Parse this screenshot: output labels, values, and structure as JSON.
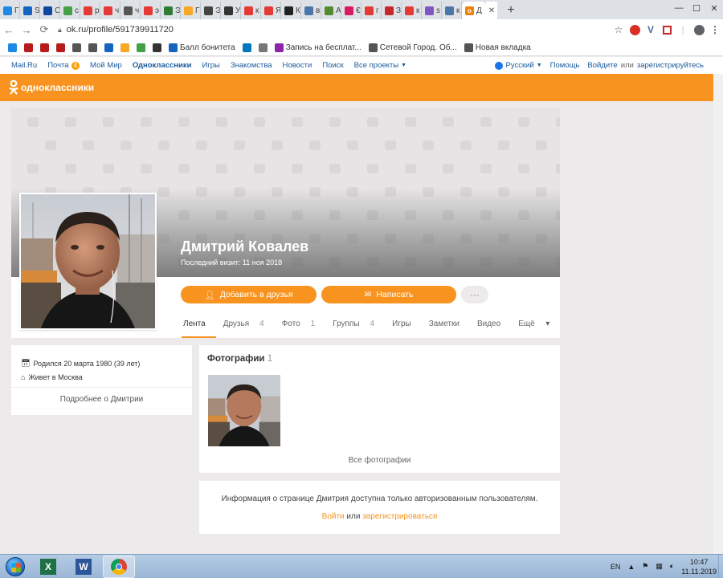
{
  "browser": {
    "tabs": [
      {
        "letter": "Г",
        "color": "#1e88e5",
        "icon": "ie-globe-icon"
      },
      {
        "letter": "S",
        "color": "#1565c0",
        "icon": "globe-icon"
      },
      {
        "letter": "С",
        "color": "#0d47a1",
        "icon": "chinese-char-icon"
      },
      {
        "letter": "с",
        "color": "#43a047",
        "icon": "leaf-icon"
      },
      {
        "letter": "р",
        "color": "#e53935",
        "icon": "yandex-icon"
      },
      {
        "letter": "ч",
        "color": "#e53935",
        "icon": "yandex-icon"
      },
      {
        "letter": "ч",
        "color": "#555555",
        "icon": "globe-icon"
      },
      {
        "letter": "э",
        "color": "#e53935",
        "icon": "yandex-icon"
      },
      {
        "letter": "Э",
        "color": "#2e7d32",
        "icon": "horse-icon"
      },
      {
        "letter": "Г",
        "color": "#f9a825",
        "icon": "k-icon"
      },
      {
        "letter": "Э",
        "color": "#444444",
        "icon": "wn-icon"
      },
      {
        "letter": "У",
        "color": "#333333",
        "icon": "graduation-cap-icon"
      },
      {
        "letter": "к",
        "color": "#e53935",
        "icon": "yandex-icon"
      },
      {
        "letter": "Я",
        "color": "#e53935",
        "icon": "map-pin-icon"
      },
      {
        "letter": "К",
        "color": "#222222",
        "icon": "horse-icon"
      },
      {
        "letter": "в",
        "color": "#4a76a8",
        "icon": "vk-icon"
      },
      {
        "letter": "А",
        "color": "#558b2f",
        "icon": "badge-icon"
      },
      {
        "letter": "€",
        "color": "#d81b60",
        "icon": "instagram-icon"
      },
      {
        "letter": "г",
        "color": "#e53935",
        "icon": "yandex-icon"
      },
      {
        "letter": "З",
        "color": "#c62828",
        "icon": "x-icon"
      },
      {
        "letter": "к",
        "color": "#e53935",
        "icon": "yandex-icon"
      },
      {
        "letter": "s",
        "color": "#7e57c2",
        "icon": "gear-icon"
      },
      {
        "letter": "к",
        "color": "#4a76a8",
        "icon": "vk-icon"
      }
    ],
    "active_tab": "Д",
    "url": "ok.ru/profile/591739911720",
    "bookmarks": [
      {
        "label": "",
        "color": "#1e88e5",
        "icon": "mail-icon"
      },
      {
        "label": "",
        "color": "#b71c1c",
        "icon": "eagle-icon"
      },
      {
        "label": "",
        "color": "#b71c1c",
        "icon": "eagle-icon"
      },
      {
        "label": "",
        "color": "#b71c1c",
        "icon": "eagle-icon"
      },
      {
        "label": "",
        "color": "#555555",
        "icon": "globe-icon"
      },
      {
        "label": "",
        "color": "#555555",
        "icon": "globe-icon"
      },
      {
        "label": "",
        "color": "#1565c0",
        "icon": "arrows-icon"
      },
      {
        "label": "",
        "color": "#f9a825",
        "icon": "sun-icon"
      },
      {
        "label": "",
        "color": "#43a047",
        "icon": "h-icon"
      },
      {
        "label": "",
        "color": "#333333",
        "icon": "film-icon"
      },
      {
        "label": "Балл бонитета",
        "color": "#1565c0",
        "icon": "bookmark-icon"
      },
      {
        "label": "",
        "color": "#0277bd",
        "icon": "cd-icon"
      },
      {
        "label": "",
        "color": "#777777",
        "icon": "eagle-icon"
      },
      {
        "label": "Запись на бесплат...",
        "color": "#8e24aa",
        "icon": "people-icon"
      },
      {
        "label": "Сетевой Город. Об...",
        "color": "#555555",
        "icon": "page-icon"
      },
      {
        "label": "Новая вкладка",
        "color": "#555555",
        "icon": "globe-icon"
      }
    ]
  },
  "portal": {
    "links": [
      "Mail.Ru",
      "Почта",
      "Мой Мир",
      "Одноклассники",
      "Игры",
      "Знакомства",
      "Новости",
      "Поиск",
      "Все проекты"
    ],
    "mail_badge": "4",
    "language": "Русский",
    "help": "Помощь",
    "login": "Войдите",
    "or": "или",
    "register": "зарегистрируйтесь"
  },
  "site": {
    "logo": "одноклассники",
    "accent": "#f7931e"
  },
  "profile": {
    "name": "Дмитрий Ковалев",
    "last_visit": "Последний визит: 11 ноя 2018",
    "add_friend": "Добавить в друзья",
    "write": "Написать",
    "more": "···",
    "tabs": [
      {
        "label": "Лента",
        "count": ""
      },
      {
        "label": "Друзья",
        "count": "4"
      },
      {
        "label": "Фото",
        "count": "1"
      },
      {
        "label": "Группы",
        "count": "4"
      },
      {
        "label": "Игры",
        "count": ""
      },
      {
        "label": "Заметки",
        "count": ""
      },
      {
        "label": "Видео",
        "count": ""
      },
      {
        "label": "Ещё",
        "count": ""
      }
    ],
    "born": "Родился 20 марта 1980 (39 лет)",
    "lives": "Живет в Москва",
    "more_about": "Подробнее о Дмитрии"
  },
  "photos": {
    "title": "Фотографии",
    "count": "1",
    "all": "Все фотографии"
  },
  "auth": {
    "message": "Информация о странице Дмитрия доступна только авторизованным пользователям.",
    "login": "Войти",
    "or": "или",
    "register": "зарегистрироваться"
  },
  "taskbar": {
    "lang": "EN",
    "time": "10:47",
    "date": "11.11.2019"
  }
}
